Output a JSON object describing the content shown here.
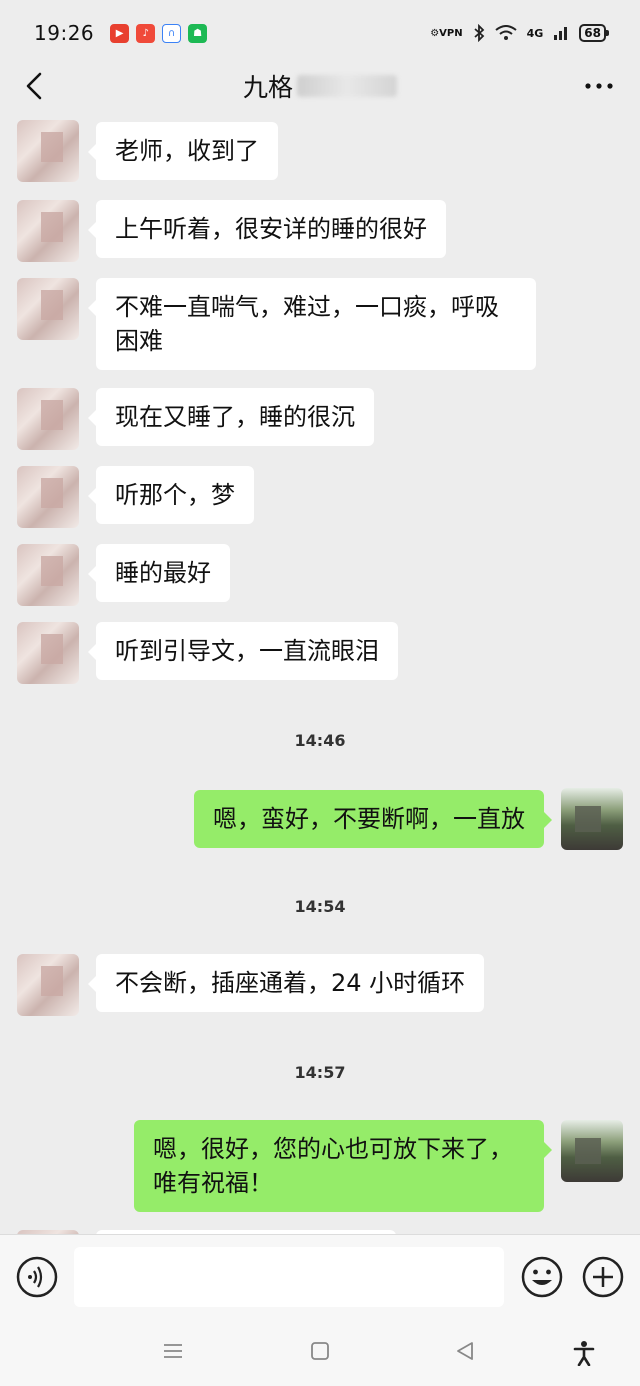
{
  "status_bar": {
    "time": "19:26",
    "app_icons": [
      {
        "name": "video-app-icon",
        "color": "#e8402f"
      },
      {
        "name": "music-app-icon",
        "color": "#f04a3a"
      },
      {
        "name": "headset-app-icon",
        "color": "#3b82f6"
      },
      {
        "name": "android-app-icon",
        "color": "#1db954"
      }
    ],
    "vpn": "VPN",
    "network": "4G",
    "battery": "68"
  },
  "nav": {
    "title": "九格"
  },
  "messages": [
    {
      "side": "other",
      "text": "老师，收到了"
    },
    {
      "side": "other",
      "text": "上午听着，很安详的睡的很好"
    },
    {
      "side": "other",
      "text": "不难一直喘气，难过，一口痰，呼吸困难"
    },
    {
      "side": "other",
      "text": "现在又睡了，睡的很沉"
    },
    {
      "side": "other",
      "text": "听那个，梦"
    },
    {
      "side": "other",
      "text": "睡的最好"
    },
    {
      "side": "other",
      "text": "听到引导文，一直流眼泪"
    },
    {
      "side": "self",
      "text": "嗯，蛮好，不要断啊，一直放"
    },
    {
      "side": "other",
      "text": "不会断，插座通着，24 小时循环"
    },
    {
      "side": "self",
      "text": "嗯，很好，您的心也可放下来了，唯有祝福！"
    }
  ],
  "timestamps": [
    "14:46",
    "14:54",
    "14:57"
  ],
  "input": {
    "placeholder": ""
  }
}
